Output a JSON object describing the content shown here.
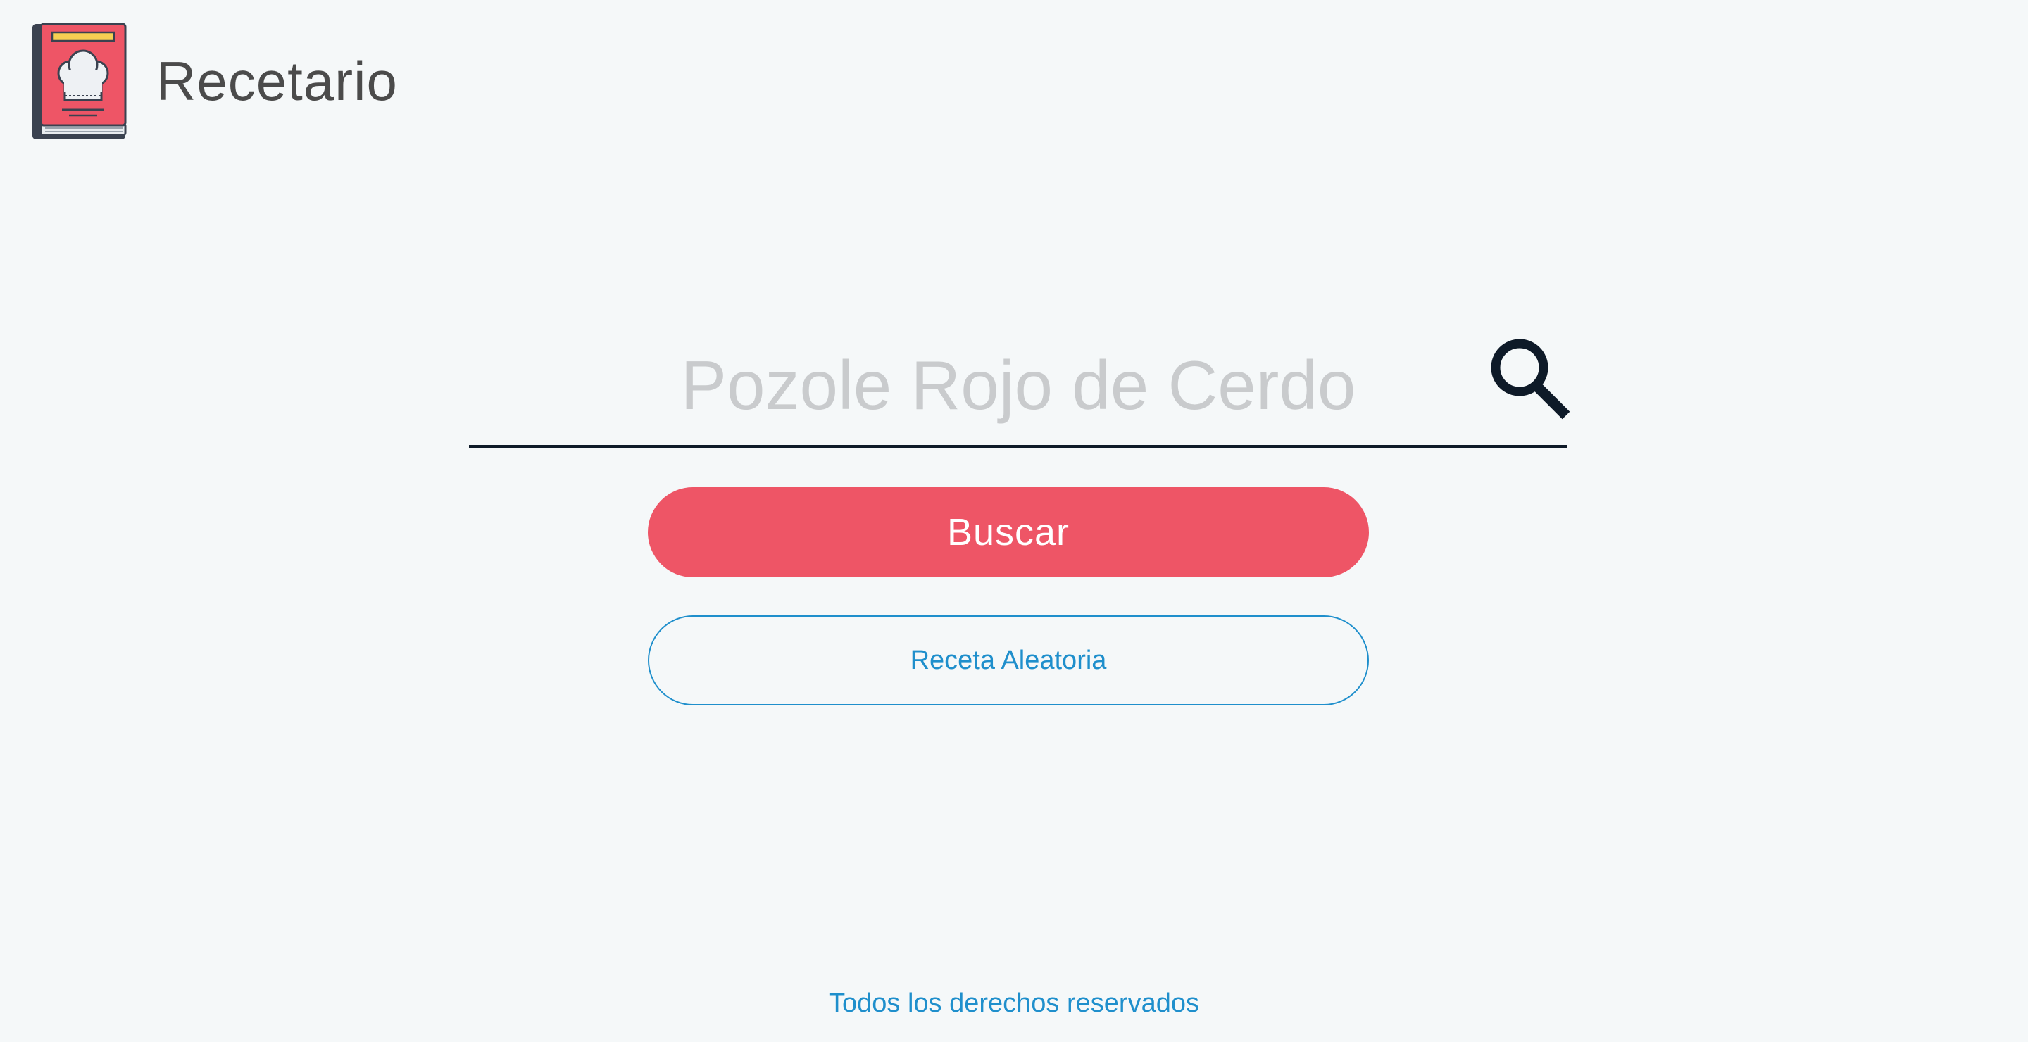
{
  "header": {
    "app_title": "Recetario",
    "logo_icon": "cookbook-chef-hat-icon"
  },
  "search": {
    "placeholder": "Pozole Rojo de Cerdo",
    "value": "",
    "icon": "search-icon"
  },
  "actions": {
    "search_label": "Buscar",
    "random_label": "Receta Aleatoria"
  },
  "footer": {
    "text": "Todos los derechos reservados"
  },
  "colors": {
    "background": "#f5f8f9",
    "primary": "#ee5566",
    "link": "#1f8fcc",
    "underline": "#0e1a28",
    "title_text": "#4b4b4b",
    "placeholder": "#c9cbcd"
  }
}
